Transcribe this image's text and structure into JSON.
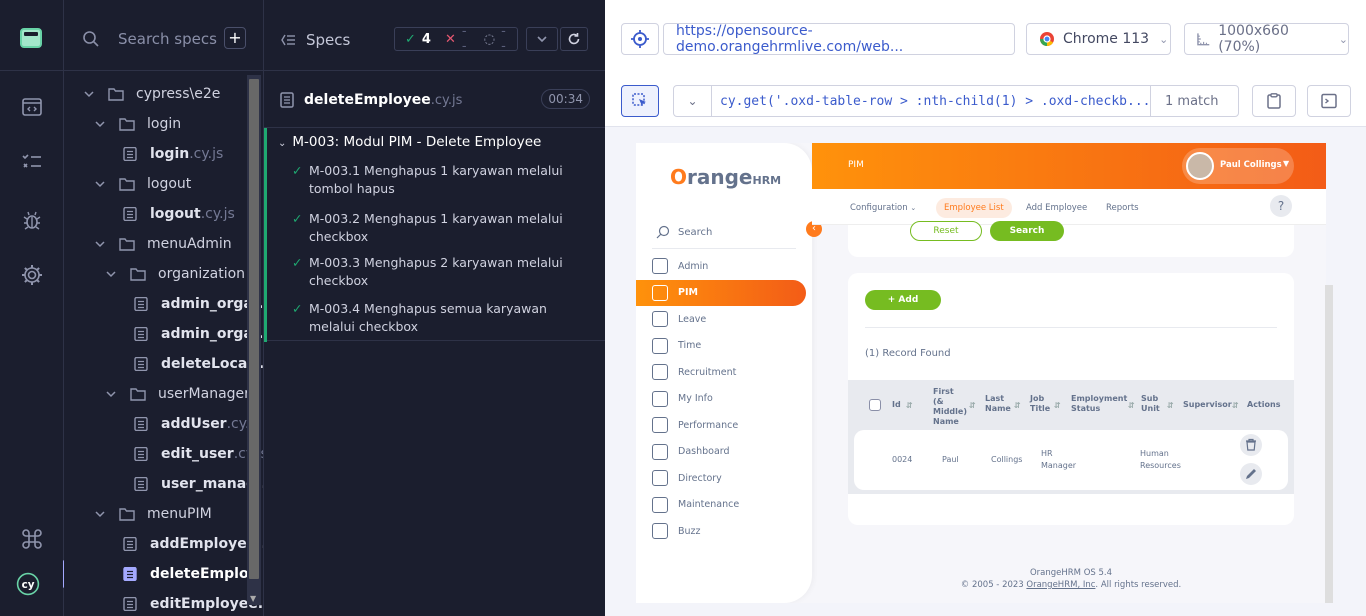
{
  "specs_panel": {
    "search_placeholder": "Search specs",
    "tree": [
      {
        "type": "folder",
        "label": "cypress\\e2e",
        "depth": 0
      },
      {
        "type": "folder",
        "label": "login",
        "depth": 1
      },
      {
        "type": "file",
        "name": "login",
        "ext": ".cy.js",
        "depth": 2
      },
      {
        "type": "folder",
        "label": "logout",
        "depth": 1
      },
      {
        "type": "file",
        "name": "logout",
        "ext": ".cy.js",
        "depth": 2
      },
      {
        "type": "folder",
        "label": "menuAdmin",
        "depth": 1
      },
      {
        "type": "folder",
        "label": "organization",
        "depth": 2
      },
      {
        "type": "file",
        "name": "admin_orga...",
        "ext": "",
        "depth": 3
      },
      {
        "type": "file",
        "name": "admin_orga...",
        "ext": "",
        "depth": 3
      },
      {
        "type": "file",
        "name": "deleteLocati...",
        "ext": "",
        "depth": 3
      },
      {
        "type": "folder",
        "label": "userManager",
        "depth": 2
      },
      {
        "type": "file",
        "name": "addUser",
        "ext": ".cy.js",
        "depth": 3
      },
      {
        "type": "file",
        "name": "edit_user",
        "ext": ".cy.js",
        "depth": 3
      },
      {
        "type": "file",
        "name": "user_manag...",
        "ext": "",
        "depth": 3
      },
      {
        "type": "folder",
        "label": "menuPIM",
        "depth": 1
      },
      {
        "type": "file",
        "name": "addEmployee...",
        "ext": "",
        "depth": 2
      },
      {
        "type": "file",
        "name": "deleteEmploy...",
        "ext": "",
        "depth": 2,
        "active": true
      },
      {
        "type": "file",
        "name": "editEmployee...",
        "ext": "",
        "depth": 2
      }
    ]
  },
  "reporter": {
    "specs_label": "Specs",
    "passed": "4",
    "failed": "--",
    "pending": "--",
    "file_name": "deleteEmployee",
    "file_ext": ".cy.js",
    "duration": "00:34",
    "suite_title": "M-003: Modul PIM - Delete Employee",
    "tests": [
      "M-003.1 Menghapus 1 karyawan melalui tombol hapus",
      "M-003.2 Menghapus 1 karyawan melalui checkbox",
      "M-003.3 Menghapus 2 karyawan melalui checkbox",
      "M-003.4 Menghapus semua karyawan melalui checkbox"
    ]
  },
  "aut": {
    "url": "https://opensource-demo.orangehrmlive.com/web...",
    "browser": "Chrome 113",
    "viewport": "1000x660 (70%)",
    "selector": "cy.get('.oxd-table-row > :nth-child(1) > .oxd-checkb...",
    "match": "1 match"
  },
  "app": {
    "logo_orange": "O",
    "logo_range": "range",
    "logo_hrm": "HRM",
    "search_label": "Search",
    "menu": [
      "Admin",
      "PIM",
      "Leave",
      "Time",
      "Recruitment",
      "My Info",
      "Performance",
      "Dashboard",
      "Directory",
      "Maintenance",
      "Buzz"
    ],
    "module": "PIM",
    "user": "Paul Collings",
    "tabs": [
      "Configuration",
      "Employee List",
      "Add Employee",
      "Reports"
    ],
    "help": "?",
    "reset": "Reset",
    "search": "Search",
    "add": "+ Add",
    "records": "(1) Record Found",
    "headers": {
      "id": "Id",
      "first": "First (& Middle) Name",
      "last": "Last Name",
      "job": "Job Title",
      "status": "Employment Status",
      "sub": "Sub Unit",
      "supervisor": "Supervisor",
      "actions": "Actions"
    },
    "row": {
      "id": "0024",
      "first": "Paul",
      "last": "Collings",
      "job": "HR Manager",
      "sub": "Human Resources"
    },
    "footer_1": "OrangeHRM OS 5.4",
    "footer_2a": "© 2005 - 2023 ",
    "footer_2b": "OrangeHRM, Inc",
    "footer_2c": ". All rights reserved."
  }
}
